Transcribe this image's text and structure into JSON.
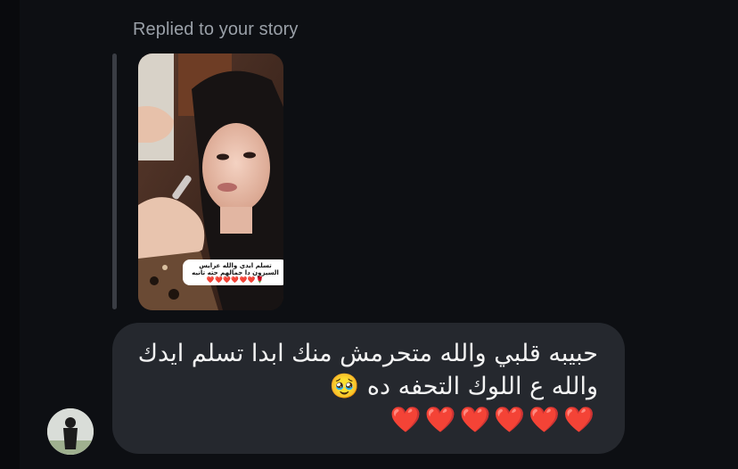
{
  "thread": {
    "reply_label": "Replied to your story"
  },
  "story": {
    "caption_line1": "تسلم ايدي والله عرايس",
    "caption_line2": "السيزون دا جمالهم حته تانيه",
    "caption_hearts": "🌹❤️❤️❤️❤️❤️❤️"
  },
  "message": {
    "line1": "حبيبه قلبي والله متحرمش منك ابدا تسلم ايدك",
    "line2": "والله ع اللوك التحفه ده 🥹",
    "line3": "❤️❤️❤️❤️❤️❤️"
  },
  "sender": {
    "avatar_icon": "user-avatar"
  },
  "colors": {
    "background": "#0d0f13",
    "bubble": "#25282e",
    "reply_bar": "#3a3d44",
    "label": "#9aa0a8"
  }
}
